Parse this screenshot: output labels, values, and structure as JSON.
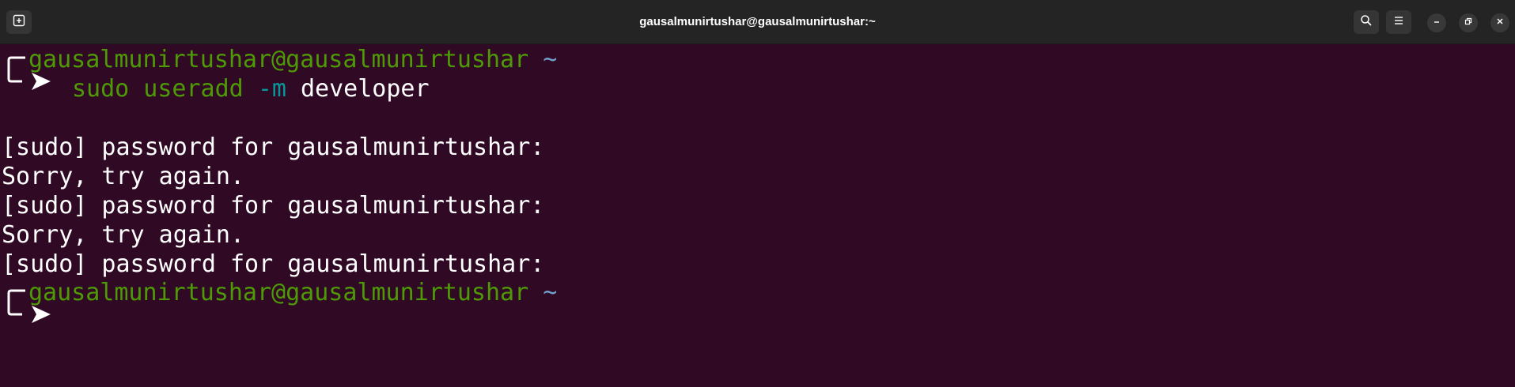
{
  "window": {
    "title": "gausalmunirtushar@gausalmunirtushar:~"
  },
  "toolbar": {
    "new_tab_icon": "new-tab-icon",
    "search_icon": "search-icon",
    "menu_icon": "hamburger-menu-icon",
    "minimize_icon": "minimize-icon",
    "maximize_icon": "restore-icon",
    "close_icon": "close-icon"
  },
  "terminal": {
    "prompt1": {
      "user_host": "gausalmunirtushar@gausalmunirtushar",
      "dir": "~",
      "command": "sudo useradd",
      "flag": "-m",
      "argument": "developer"
    },
    "output": [
      "[sudo] password for gausalmunirtushar:",
      "Sorry, try again.",
      "[sudo] password for gausalmunirtushar:",
      "Sorry, try again.",
      "[sudo] password for gausalmunirtushar:"
    ],
    "prompt2": {
      "user_host": "gausalmunirtushar@gausalmunirtushar",
      "dir": "~"
    }
  },
  "colors": {
    "background": "#300a24",
    "titlebar": "#242424",
    "prompt_green": "#4e9a06",
    "prompt_blue": "#729fcf",
    "flag_cyan": "#06989a",
    "text": "#ffffff"
  }
}
